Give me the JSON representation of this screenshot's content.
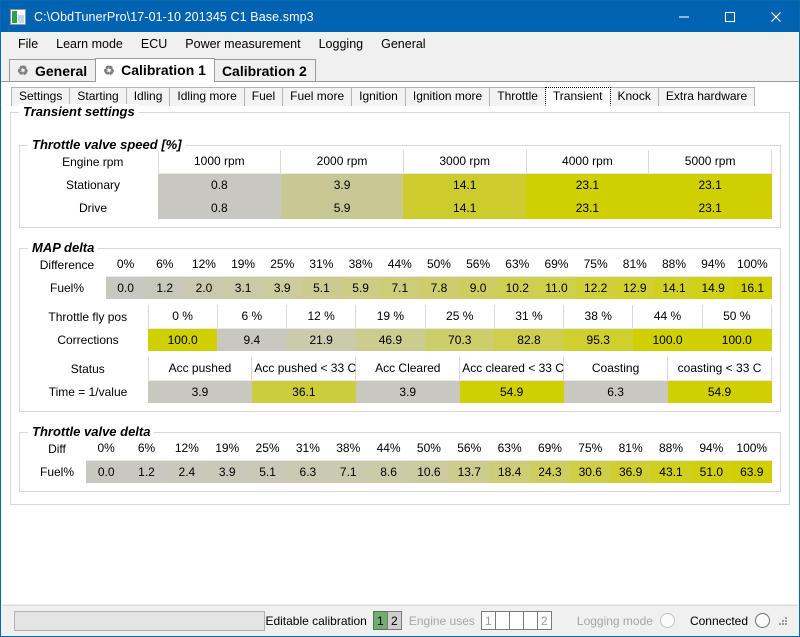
{
  "window": {
    "title": "C:\\ObdTunerPro\\17-01-10 201345 C1 Base.smp3",
    "minimize_label": "—",
    "maximize_label": "□",
    "close_label": "✕"
  },
  "menu": {
    "items": [
      "File",
      "Learn mode",
      "ECU",
      "Power measurement",
      "Logging",
      "General"
    ]
  },
  "main_tabs": [
    {
      "label": "General",
      "active": false
    },
    {
      "label": "Calibration 1",
      "active": true
    },
    {
      "label": "Calibration 2",
      "active": false
    }
  ],
  "sub_tabs": [
    {
      "label": "Settings",
      "active": false
    },
    {
      "label": "Starting",
      "active": false
    },
    {
      "label": "Idling",
      "active": false
    },
    {
      "label": "Idling more",
      "active": false
    },
    {
      "label": "Fuel",
      "active": false
    },
    {
      "label": "Fuel more",
      "active": false
    },
    {
      "label": "Ignition",
      "active": false
    },
    {
      "label": "Ignition more",
      "active": false
    },
    {
      "label": "Throttle",
      "active": false
    },
    {
      "label": "Transient",
      "active": true
    },
    {
      "label": "Knock",
      "active": false
    },
    {
      "label": "Extra hardware",
      "active": false
    }
  ],
  "groups": {
    "transient_settings": "Transient settings",
    "throttle_valve_speed": "Throttle valve speed [%]",
    "map_delta": "MAP delta",
    "throttle_valve_delta": "Throttle valve delta"
  },
  "throttle_valve_speed": {
    "row_labels": [
      "Engine rpm",
      "Stationary",
      "Drive"
    ],
    "headers": [
      "1000 rpm",
      "2000 rpm",
      "3000 rpm",
      "4000 rpm",
      "5000 rpm"
    ],
    "stationary": [
      "0.8",
      "3.9",
      "14.1",
      "23.1",
      "23.1"
    ],
    "stationary_colors": [
      "#c8c8c0",
      "#c8c894",
      "#cccc2e",
      "#d0d000",
      "#d0d000"
    ],
    "drive": [
      "0.8",
      "5.9",
      "14.1",
      "23.1",
      "23.1"
    ],
    "drive_colors": [
      "#c8c8c0",
      "#c8c894",
      "#cccc2e",
      "#d0d000",
      "#d0d000"
    ]
  },
  "map_delta": {
    "difference_label": "Difference",
    "fuel_label": "Fuel%",
    "difference": [
      "0%",
      "6%",
      "12%",
      "19%",
      "25%",
      "31%",
      "38%",
      "44%",
      "50%",
      "56%",
      "63%",
      "69%",
      "75%",
      "81%",
      "88%",
      "94%",
      "100%"
    ],
    "fuel": [
      "0.0",
      "1.2",
      "2.0",
      "3.1",
      "3.9",
      "5.1",
      "5.9",
      "7.1",
      "7.8",
      "9.0",
      "10.2",
      "11.0",
      "12.2",
      "12.9",
      "14.1",
      "14.9",
      "16.1"
    ],
    "fuel_colors": [
      "#c8c8c0",
      "#c8c8ba",
      "#c9c9b0",
      "#cacaa6",
      "#cbcb9c",
      "#cbcb90",
      "#cccc86",
      "#cdcd78",
      "#cdcd6e",
      "#cece60",
      "#cece52",
      "#cfcf48",
      "#cfcf3a",
      "#d0d030",
      "#d0d022",
      "#d0d014",
      "#d0d000"
    ],
    "throttle_fly_label": "Throttle fly pos",
    "corrections_label": "Corrections",
    "throttle_fly": [
      "0 %",
      "6 %",
      "12 %",
      "19 %",
      "25 %",
      "31 %",
      "38 %",
      "44 %",
      "50 %"
    ],
    "corrections": [
      "100.0",
      "9.4",
      "21.9",
      "46.9",
      "70.3",
      "82.8",
      "95.3",
      "100.0",
      "100.0"
    ],
    "corrections_colors": [
      "#d0d000",
      "#c8c8c0",
      "#cacaad",
      "#cccc8e",
      "#cdcd6a",
      "#cece50",
      "#cfcf2e",
      "#d0d000",
      "#d0d000"
    ],
    "status_label": "Status",
    "time_label": "Time = 1/value",
    "status": [
      "Acc pushed",
      "Acc pushed < 33 C",
      "Acc Cleared",
      "Acc cleared < 33 C",
      "Coasting",
      "coasting < 33 C"
    ],
    "time_values": [
      "3.9",
      "36.1",
      "3.9",
      "54.9",
      "6.3",
      "54.9"
    ],
    "time_colors": [
      "#c8c8c0",
      "#cccc3c",
      "#c8c8c0",
      "#d0d000",
      "#c8c8c0",
      "#d0d000"
    ]
  },
  "throttle_valve_delta": {
    "diff_label": "Diff",
    "fuel_label": "Fuel%",
    "diff": [
      "0%",
      "6%",
      "12%",
      "19%",
      "25%",
      "31%",
      "38%",
      "44%",
      "50%",
      "56%",
      "63%",
      "69%",
      "75%",
      "81%",
      "88%",
      "94%",
      "100%"
    ],
    "fuel": [
      "0.0",
      "1.2",
      "2.4",
      "3.9",
      "5.1",
      "6.3",
      "7.1",
      "8.6",
      "10.6",
      "13.7",
      "18.4",
      "24.3",
      "30.6",
      "36.9",
      "43.1",
      "51.0",
      "63.9"
    ],
    "fuel_colors": [
      "#c8c8c0",
      "#c8c8c0",
      "#c8c8bd",
      "#c9c9ba",
      "#c9c9b6",
      "#cacab2",
      "#cacaae",
      "#cbcba8",
      "#cbcb9e",
      "#cccc8e",
      "#cdcd78",
      "#cece5e",
      "#cece48",
      "#cfcf34",
      "#cfcf20",
      "#d0d010",
      "#d0d000"
    ]
  },
  "status_bar": {
    "editable_calibration": "Editable calibration",
    "cal_cells": [
      {
        "label": "1",
        "state": "green"
      },
      {
        "label": "2",
        "state": "gray"
      }
    ],
    "engine_uses": "Engine uses",
    "engine_cells": [
      "1",
      "",
      "",
      "",
      "2"
    ],
    "logging_mode": "Logging mode",
    "connected": "Connected"
  }
}
